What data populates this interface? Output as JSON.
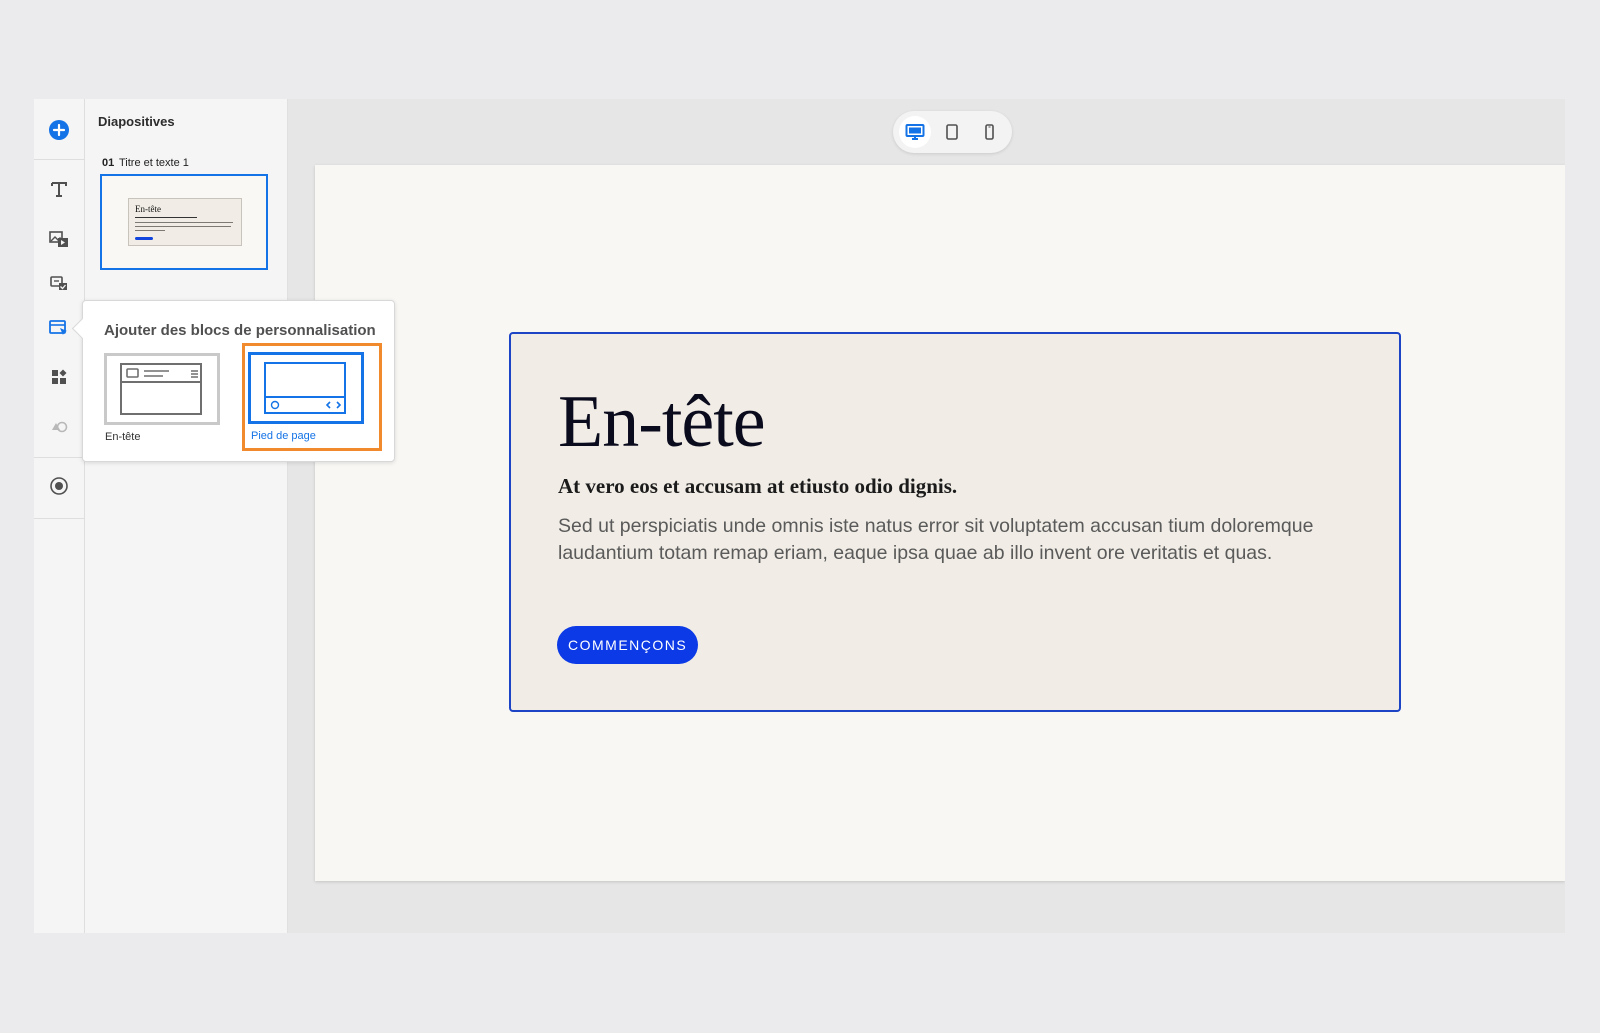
{
  "colors": {
    "accent": "#1473e6",
    "highlight": "#f08a2c",
    "cta": "#0b3ae6",
    "card_border": "#1d44c4"
  },
  "toolbar": {
    "items": [
      {
        "name": "add-icon"
      },
      {
        "name": "text-icon"
      },
      {
        "name": "media-icon"
      },
      {
        "name": "form-icon"
      },
      {
        "name": "personalization-blocks-icon",
        "active": true
      },
      {
        "name": "components-icon"
      },
      {
        "name": "history-icon",
        "disabled": true
      },
      {
        "name": "record-icon"
      }
    ]
  },
  "slides_panel": {
    "title": "Diapositives",
    "slides": [
      {
        "number": "01",
        "name": "Titre et texte 1",
        "thumb_title": "En-tête"
      }
    ]
  },
  "popover": {
    "title": "Ajouter des blocs de personnalisation",
    "options": [
      {
        "label": "En-tête",
        "selected": false
      },
      {
        "label": "Pied de page",
        "selected": true
      }
    ]
  },
  "device_switch": {
    "options": [
      {
        "name": "desktop-icon",
        "active": true
      },
      {
        "name": "tablet-icon",
        "active": false
      },
      {
        "name": "mobile-icon",
        "active": false
      }
    ]
  },
  "slide": {
    "heading": "En-tête",
    "subheading": "At vero eos et accusam at etiusto odio dignis.",
    "body": "Sed ut perspiciatis unde omnis iste natus error sit voluptatem accusan tium doloremque laudantium totam remap eriam, eaque ipsa quae ab illo invent ore veritatis et quas.",
    "cta_label": "COMMENÇONS"
  }
}
